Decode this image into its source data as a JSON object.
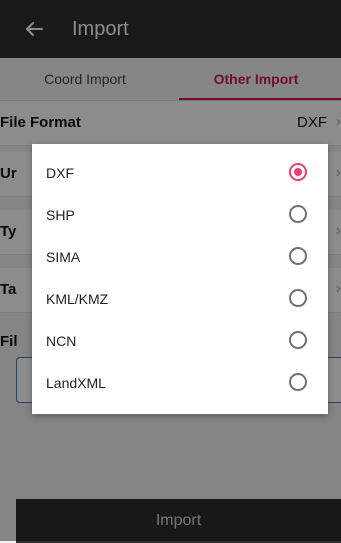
{
  "topbar": {
    "title": "Import"
  },
  "tabs": [
    {
      "label": "Coord Import",
      "active": false
    },
    {
      "label": "Other Import",
      "active": true
    }
  ],
  "form": {
    "file_format_label": "File Format",
    "file_format_value": "DXF",
    "unit_label_partial": "Ur",
    "type_label_partial": "Ty",
    "target_label_partial": "Ta",
    "file_label_partial": "Fil"
  },
  "dialog": {
    "options": [
      {
        "label": "DXF",
        "selected": true
      },
      {
        "label": "SHP",
        "selected": false
      },
      {
        "label": "SIMA",
        "selected": false
      },
      {
        "label": "KML/KMZ",
        "selected": false
      },
      {
        "label": "NCN",
        "selected": false
      },
      {
        "label": "LandXML",
        "selected": false
      }
    ]
  },
  "footer": {
    "import_button": "Import"
  },
  "colors": {
    "topbar_bg": "#2f2f2f",
    "accent": "#e83f73",
    "tab_active": "#cc1f45"
  }
}
